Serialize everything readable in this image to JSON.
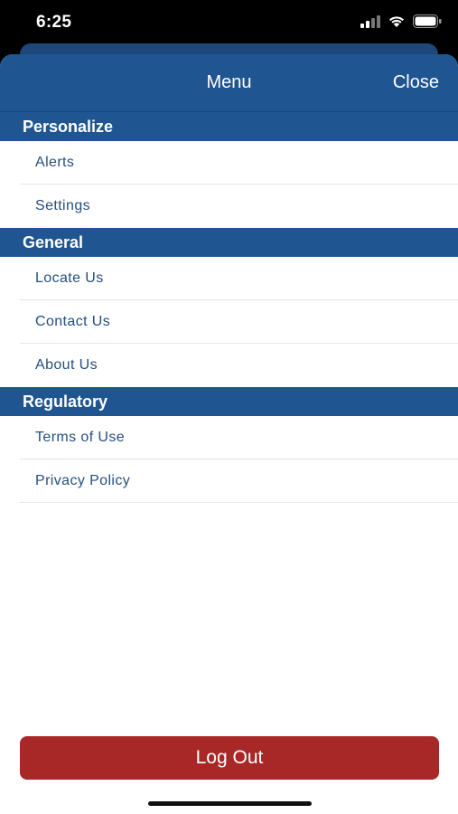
{
  "status_bar": {
    "time": "6:25"
  },
  "nav": {
    "title": "Menu",
    "close_label": "Close"
  },
  "sections": [
    {
      "title": "Personalize",
      "items": [
        {
          "label": "Alerts"
        },
        {
          "label": "Settings"
        }
      ]
    },
    {
      "title": "General",
      "items": [
        {
          "label": "Locate Us"
        },
        {
          "label": "Contact Us"
        },
        {
          "label": "About Us"
        }
      ]
    },
    {
      "title": "Regulatory",
      "items": [
        {
          "label": "Terms of Use"
        },
        {
          "label": "Privacy Policy"
        }
      ]
    }
  ],
  "footer": {
    "logout_label": "Log Out"
  },
  "colors": {
    "header_blue": "#1f5590",
    "item_text": "#244f7f",
    "logout_red": "#a82828"
  }
}
